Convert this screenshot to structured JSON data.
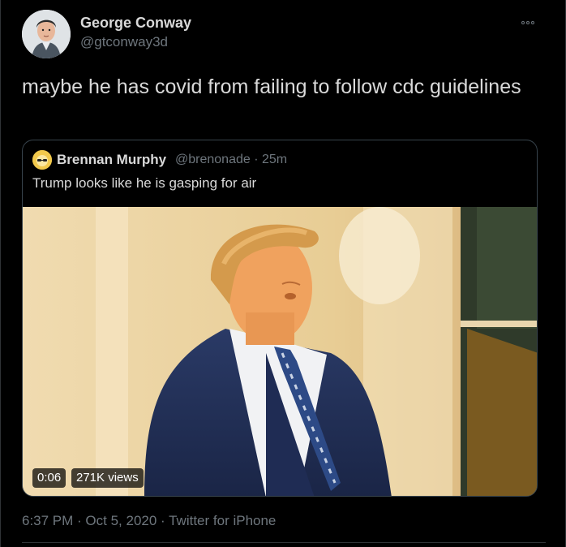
{
  "tweet": {
    "author_name": "George Conway",
    "author_handle": "@gtconway3d",
    "more_icon": "more-horizontal-icon",
    "text": "maybe he has covid from failing to follow cdc guidelines",
    "timestamp": "6:37 PM · Oct 5, 2020",
    "source": "Twitter for iPhone",
    "meta_line": "6:37 PM · Oct 5, 2020 · Twitter for iPhone"
  },
  "quote": {
    "author_name": "Brennan Murphy",
    "author_handle": "@brenonade · 25m",
    "text": "Trump looks like he is gasping for air",
    "video": {
      "duration": "0:06",
      "views": "271K views"
    }
  },
  "colors": {
    "background": "#000000",
    "text_primary": "#d9d9d9",
    "text_secondary": "#6e767d",
    "border": "#38444d"
  }
}
